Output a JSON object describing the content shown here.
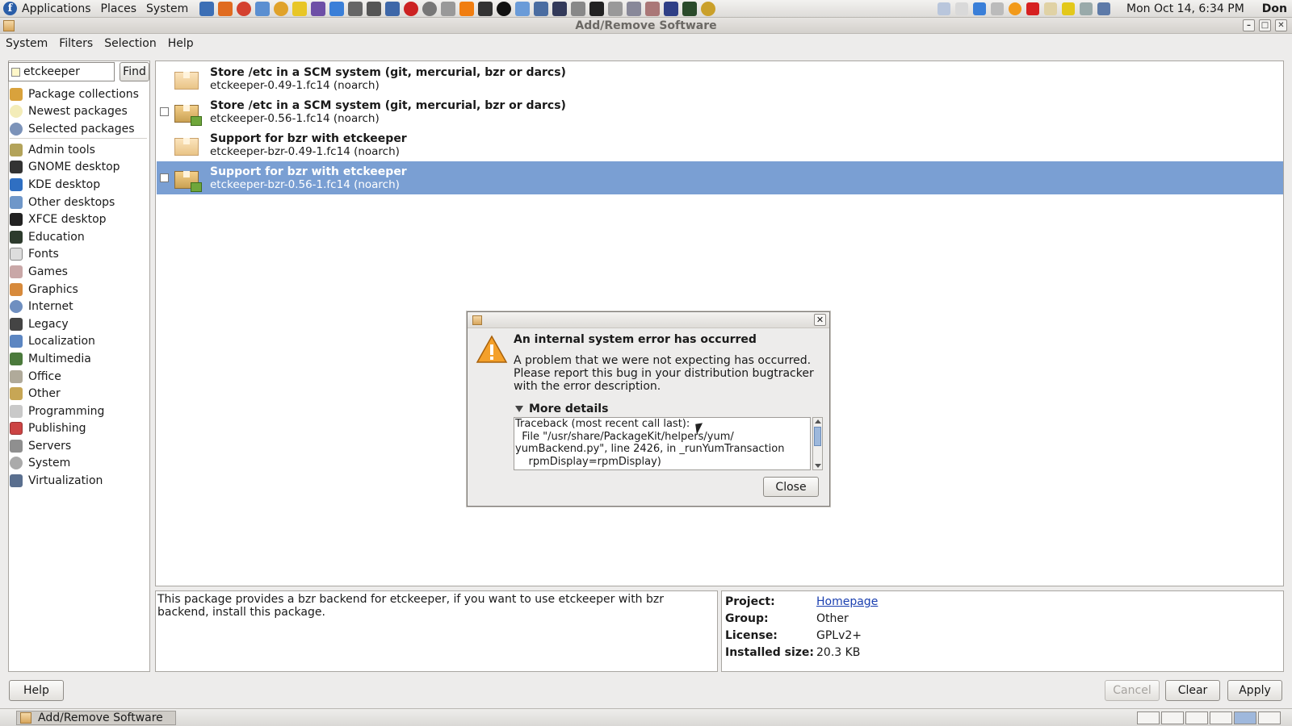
{
  "top_panel": {
    "menus": [
      "Applications",
      "Places",
      "System"
    ],
    "clock": "Mon Oct 14,  6:34 PM",
    "user": "Don"
  },
  "window": {
    "title": "Add/Remove Software",
    "menubar": [
      "System",
      "Filters",
      "Selection",
      "Help"
    ]
  },
  "search": {
    "value": "etckeeper",
    "find_label": "Find"
  },
  "sidebar": {
    "top_items": [
      {
        "label": "Package collections",
        "icon": "package-collections-icon"
      },
      {
        "label": "Newest packages",
        "icon": "lightbulb-icon"
      },
      {
        "label": "Selected packages",
        "icon": "magnifier-icon"
      }
    ],
    "groups": [
      {
        "label": "Admin tools",
        "icon": "admin-tools-icon"
      },
      {
        "label": "GNOME desktop",
        "icon": "gnome-foot-icon"
      },
      {
        "label": "KDE desktop",
        "icon": "kde-icon"
      },
      {
        "label": "Other desktops",
        "icon": "desktop-icon"
      },
      {
        "label": "XFCE desktop",
        "icon": "xfce-mouse-icon"
      },
      {
        "label": "Education",
        "icon": "education-icon"
      },
      {
        "label": "Fonts",
        "icon": "fonts-icon"
      },
      {
        "label": "Games",
        "icon": "games-icon"
      },
      {
        "label": "Graphics",
        "icon": "graphics-icon"
      },
      {
        "label": "Internet",
        "icon": "globe-icon"
      },
      {
        "label": "Legacy",
        "icon": "floppy-icon"
      },
      {
        "label": "Localization",
        "icon": "localization-icon"
      },
      {
        "label": "Multimedia",
        "icon": "multimedia-icon"
      },
      {
        "label": "Office",
        "icon": "office-icon"
      },
      {
        "label": "Other",
        "icon": "other-icon"
      },
      {
        "label": "Programming",
        "icon": "programming-icon"
      },
      {
        "label": "Publishing",
        "icon": "publishing-icon"
      },
      {
        "label": "Servers",
        "icon": "servers-icon"
      },
      {
        "label": "System",
        "icon": "system-gear-icon"
      },
      {
        "label": "Virtualization",
        "icon": "virtualization-icon"
      }
    ]
  },
  "packages": [
    {
      "summary": "Store /etc in a SCM system (git, mercurial, bzr or darcs)",
      "name": "etckeeper-0.49-1.fc14 (noarch)",
      "installed": false,
      "checkbox": false
    },
    {
      "summary": "Store /etc in a SCM system (git, mercurial, bzr or darcs)",
      "name": "etckeeper-0.56-1.fc14 (noarch)",
      "installed": true,
      "checkbox": true
    },
    {
      "summary": "Support for bzr with etckeeper",
      "name": "etckeeper-bzr-0.49-1.fc14 (noarch)",
      "installed": false,
      "checkbox": false
    },
    {
      "summary": "Support for bzr with etckeeper",
      "name": "etckeeper-bzr-0.56-1.fc14 (noarch)",
      "installed": true,
      "checkbox": true,
      "selected": true
    }
  ],
  "description": "This package provides a bzr backend for etckeeper, if you want to use etckeeper with bzr backend, install this package.",
  "details": {
    "project_key": "Project:",
    "project_value": "Homepage",
    "group_key": "Group:",
    "group_value": "Other",
    "license_key": "License:",
    "license_value": "GPLv2+",
    "size_key": "Installed size:",
    "size_value": "20.3 KB"
  },
  "buttons": {
    "help": "Help",
    "cancel": "Cancel",
    "clear": "Clear",
    "apply": "Apply"
  },
  "taskbar": {
    "item": "Add/Remove Software"
  },
  "dialog": {
    "heading": "An internal system error has occurred",
    "body": "A problem that we were not expecting has occurred. Please report this bug in your distribution bugtracker with the error description.",
    "details_label": "More details",
    "traceback": "Traceback (most recent call last):\n  File \"/usr/share/PackageKit/helpers/yum/\nyumBackend.py\", line 2426, in _runYumTransaction\n    rpmDisplay=rpmDisplay)",
    "close_label": "Close"
  },
  "colors": {
    "selection": "#7a9fd3",
    "link": "#1a3fb0"
  }
}
